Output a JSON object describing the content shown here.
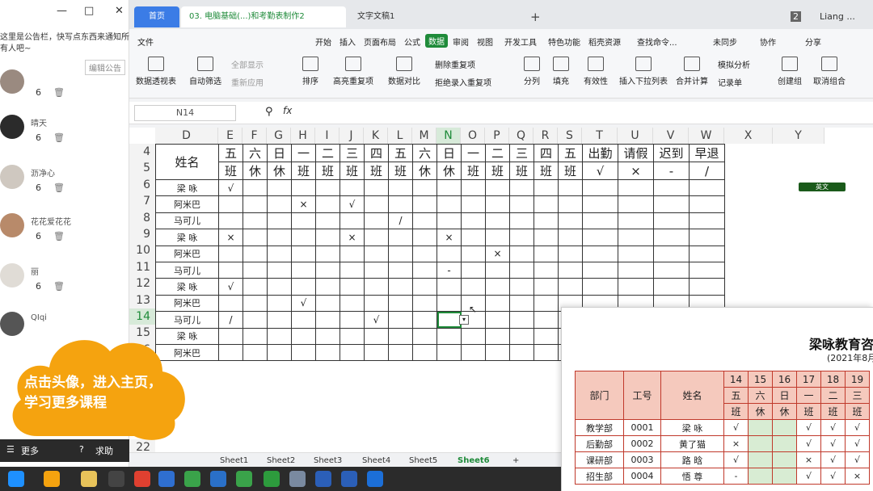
{
  "chat": {
    "window_controls": [
      "—",
      "□",
      "✕"
    ],
    "notice": "这里是公告栏，快写点东西来通知所有人吧~",
    "edit_notice": "编辑公告",
    "members": [
      {
        "name": "",
        "count": "6"
      },
      {
        "name": "晴天",
        "count": "6"
      },
      {
        "name": "沥净心",
        "count": "6"
      },
      {
        "name": "花花爱花花",
        "count": "6"
      },
      {
        "name": "丽",
        "count": "6"
      },
      {
        "name": "QIqi",
        "count": ""
      }
    ],
    "promo_text": "点击头像，进入主页，学习更多课程",
    "bottom": {
      "more": "更多",
      "help": "求助"
    }
  },
  "wps": {
    "tabs": {
      "home": "首页",
      "doc": "03. 电脑基础(...)和考勤表制作2",
      "doc2": "文字文稿1"
    },
    "right": {
      "badge": "2",
      "user": "Liang ..."
    },
    "menu": {
      "file": "文件",
      "items": [
        "开始",
        "插入",
        "页面布局",
        "公式",
        "数据",
        "审阅",
        "视图",
        "开发工具",
        "特色功能",
        "稻壳资源"
      ],
      "active": "数据",
      "search": "查找命令...",
      "sync": "未同步",
      "collab": "协作",
      "share": "分享"
    },
    "toolbar": {
      "pivot": "数据透视表",
      "autofilter": "自动筛选",
      "show_all": "全部显示",
      "reapply": "重新应用",
      "sort": "排序",
      "highlight_dup": "高亮重复项",
      "compare": "数据对比",
      "remove_dup": "删除重复项",
      "reject_dup": "拒绝录入重复项",
      "split": "分列",
      "fill": "填充",
      "validity": "有效性",
      "dropdown": "插入下拉列表",
      "consolidate": "合并计算",
      "simulate": "模拟分析",
      "record": "记录单",
      "create_group": "创建组",
      "ungroup": "取消组合"
    },
    "namebox": "N14",
    "fx": "fx",
    "columns": [
      "D",
      "E",
      "F",
      "G",
      "H",
      "I",
      "J",
      "K",
      "L",
      "M",
      "N",
      "O",
      "P",
      "Q",
      "R",
      "S",
      "T",
      "U",
      "V",
      "W",
      "X",
      "Y"
    ],
    "selected_column": "N",
    "rows": [
      "4",
      "5",
      "6",
      "7",
      "8",
      "9",
      "10",
      "11",
      "12",
      "13",
      "14",
      "15",
      "16",
      "22"
    ],
    "selected_row": "14",
    "header_row1": [
      "姓名",
      "五",
      "六",
      "日",
      "一",
      "二",
      "三",
      "四",
      "五",
      "六",
      "日",
      "一",
      "二",
      "三",
      "四",
      "五",
      "出勤",
      "请假",
      "迟到",
      "早退"
    ],
    "header_row2": [
      "班",
      "休",
      "休",
      "班",
      "班",
      "班",
      "班",
      "班",
      "休",
      "休",
      "班",
      "班",
      "班",
      "班",
      "班",
      "√",
      "×",
      "-",
      "/"
    ],
    "data_rows": [
      {
        "name": "梁 咏",
        "marks": {
          "0": "√"
        }
      },
      {
        "name": "阿米巴",
        "marks": {
          "3": "×",
          "5": "√"
        }
      },
      {
        "name": "马可儿",
        "marks": {
          "7": "/"
        }
      },
      {
        "name": "梁 咏",
        "marks": {
          "0": "×",
          "5": "×",
          "9": "×"
        }
      },
      {
        "name": "阿米巴",
        "marks": {
          "11": "×"
        }
      },
      {
        "name": "马可儿",
        "marks": {
          "9": "-"
        }
      },
      {
        "name": "梁 咏",
        "marks": {
          "0": "√"
        }
      },
      {
        "name": "阿米巴",
        "marks": {
          "3": "√"
        }
      },
      {
        "name": "马可儿",
        "marks": {
          "0": "/",
          "6": "√"
        }
      },
      {
        "name": "梁 咏",
        "marks": {}
      },
      {
        "name": "阿米巴",
        "marks": {}
      }
    ],
    "ime_label": "英文",
    "sheet_tabs": [
      "Sheet1",
      "Sheet2",
      "Sheet3",
      "Sheet4",
      "Sheet5",
      "Sheet6"
    ],
    "active_sheet": "Sheet6"
  },
  "preview": {
    "title": "梁咏教育咨",
    "subtitle": "(2021年8月",
    "head": {
      "dept": "部门",
      "id": "工号",
      "name": "姓名",
      "dates": [
        "14",
        "15",
        "16",
        "17",
        "18",
        "19"
      ],
      "weekdays": [
        "五",
        "六",
        "日",
        "一",
        "二",
        "三"
      ],
      "types": [
        "班",
        "休",
        "休",
        "班",
        "班",
        "班"
      ]
    },
    "rows": [
      {
        "dept": "教学部",
        "id": "0001",
        "name": "梁 咏",
        "marks": [
          "√",
          "",
          "",
          "√",
          "√",
          "√"
        ]
      },
      {
        "dept": "后勤部",
        "id": "0002",
        "name": "黄了猫",
        "marks": [
          "×",
          "",
          "",
          "√",
          "√",
          "√"
        ]
      },
      {
        "dept": "课研部",
        "id": "0003",
        "name": "路 晗",
        "marks": [
          "√",
          "",
          "",
          "×",
          "√",
          "√"
        ]
      },
      {
        "dept": "招生部",
        "id": "0004",
        "name": "悟 尊",
        "marks": [
          "-",
          "",
          "",
          "√",
          "√",
          "×"
        ]
      }
    ]
  }
}
